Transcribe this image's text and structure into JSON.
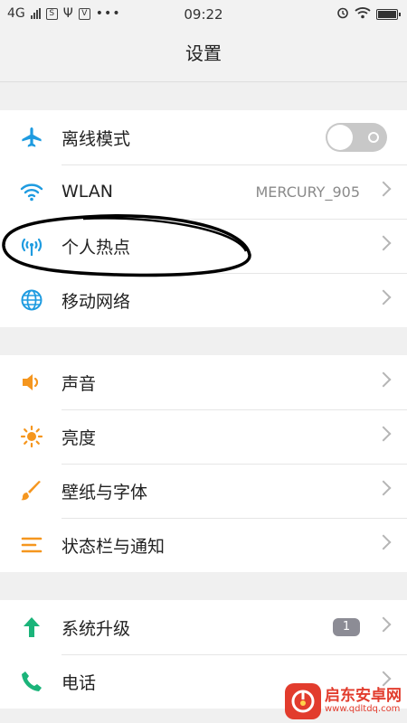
{
  "status_bar": {
    "network": "4G",
    "time": "09:22",
    "icons_left": [
      "signal-icon",
      "sim-icon",
      "usb-icon",
      "notification-icon",
      "more-icon"
    ],
    "icons_right": [
      "alarm-icon",
      "wifi-icon",
      "battery-charging-icon"
    ]
  },
  "title": "设置",
  "sections": [
    {
      "items": [
        {
          "label": "离线模式",
          "icon": "airplane-icon",
          "control": "toggle",
          "toggle_on": false
        },
        {
          "label": "WLAN",
          "icon": "wifi-icon",
          "value": "MERCURY_905",
          "control": "chevron"
        },
        {
          "label": "个人热点",
          "icon": "hotspot-icon",
          "control": "chevron"
        },
        {
          "label": "移动网络",
          "icon": "globe-icon",
          "control": "chevron"
        }
      ]
    },
    {
      "items": [
        {
          "label": "声音",
          "icon": "speaker-icon",
          "control": "chevron"
        },
        {
          "label": "亮度",
          "icon": "brightness-icon",
          "control": "chevron"
        },
        {
          "label": "壁纸与字体",
          "icon": "brush-icon",
          "control": "chevron"
        },
        {
          "label": "状态栏与通知",
          "icon": "notification-bar-icon",
          "control": "chevron"
        }
      ]
    },
    {
      "items": [
        {
          "label": "系统升级",
          "icon": "upgrade-arrow-icon",
          "badge": "1",
          "control": "chevron"
        },
        {
          "label": "电话",
          "icon": "phone-icon",
          "control": "chevron"
        }
      ]
    }
  ],
  "watermark": {
    "title": "启东安卓网",
    "url": "www.qdltdq.com"
  },
  "colors": {
    "accent_blue": "#1e9be0",
    "accent_orange": "#f5961e",
    "accent_green": "#1bb47a",
    "background": "#f0f0f0",
    "watermark_red": "#e23c2d"
  }
}
